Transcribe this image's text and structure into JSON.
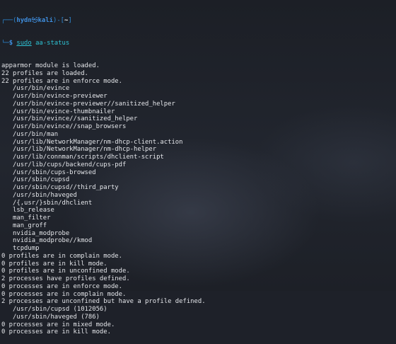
{
  "prompt": {
    "frame_top_left": "┌──(",
    "user": "hydn",
    "at": "㉿",
    "host": "kali",
    "frame_mid": ")-[",
    "path": "~",
    "frame_end": "]",
    "frame_bottom": "└─",
    "dollar": "$ ",
    "command_sudo": "sudo",
    "command_rest": " aa-status"
  },
  "output": [
    "apparmor module is loaded.",
    "22 profiles are loaded.",
    "22 profiles are in enforce mode.",
    "   /usr/bin/evince",
    "   /usr/bin/evince-previewer",
    "   /usr/bin/evince-previewer//sanitized_helper",
    "   /usr/bin/evince-thumbnailer",
    "   /usr/bin/evince//sanitized_helper",
    "   /usr/bin/evince//snap_browsers",
    "   /usr/bin/man",
    "   /usr/lib/NetworkManager/nm-dhcp-client.action",
    "   /usr/lib/NetworkManager/nm-dhcp-helper",
    "   /usr/lib/connman/scripts/dhclient-script",
    "   /usr/lib/cups/backend/cups-pdf",
    "   /usr/sbin/cups-browsed",
    "   /usr/sbin/cupsd",
    "   /usr/sbin/cupsd//third_party",
    "   /usr/sbin/haveged",
    "   /{,usr/}sbin/dhclient",
    "   lsb_release",
    "   man_filter",
    "   man_groff",
    "   nvidia_modprobe",
    "   nvidia_modprobe//kmod",
    "   tcpdump",
    "0 profiles are in complain mode.",
    "0 profiles are in kill mode.",
    "0 profiles are in unconfined mode.",
    "2 processes have profiles defined.",
    "0 processes are in enforce mode.",
    "0 processes are in complain mode.",
    "2 processes are unconfined but have a profile defined.",
    "   /usr/sbin/cupsd (1012056)",
    "   /usr/sbin/haveged (786)",
    "0 processes are in mixed mode.",
    "0 processes are in kill mode."
  ],
  "colors": {
    "background": "#1e2129",
    "prompt_blue": "#3f8fe0",
    "command_cyan": "#2ec4d6",
    "text": "#e4e6ea"
  }
}
